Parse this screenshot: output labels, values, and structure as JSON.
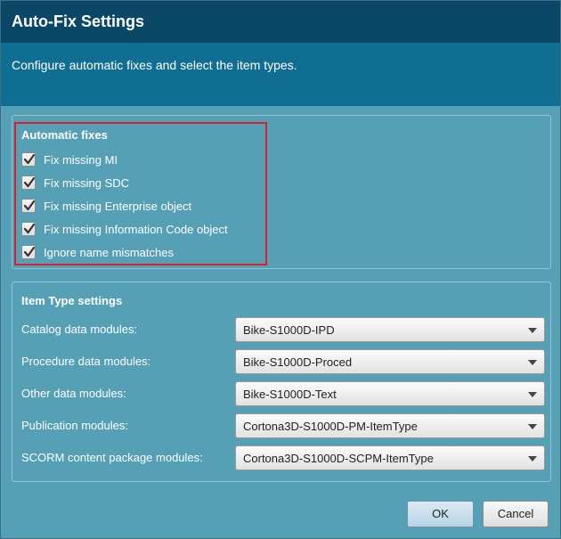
{
  "window": {
    "title": "Auto-Fix Settings"
  },
  "header": {
    "subtitle": "Configure automatic fixes and select the item types."
  },
  "automatic_fixes": {
    "title": "Automatic fixes",
    "items": [
      {
        "label": "Fix missing MI",
        "checked": true
      },
      {
        "label": "Fix missing SDC",
        "checked": true
      },
      {
        "label": "Fix missing Enterprise object",
        "checked": true
      },
      {
        "label": "Fix missing Information Code object",
        "checked": true
      },
      {
        "label": "Ignore name mismatches",
        "checked": true
      }
    ],
    "highlight_color": "#d8202f"
  },
  "item_type_settings": {
    "title": "Item Type settings",
    "fields": [
      {
        "label": "Catalog data modules:",
        "value": "Bike-S1000D-IPD"
      },
      {
        "label": "Procedure data modules:",
        "value": "Bike-S1000D-Proced"
      },
      {
        "label": "Other data modules:",
        "value": "Bike-S1000D-Text"
      },
      {
        "label": "Publication modules:",
        "value": "Cortona3D-S1000D-PM-ItemType"
      },
      {
        "label": "SCORM content package modules:",
        "value": "Cortona3D-S1000D-SCPM-ItemType"
      }
    ]
  },
  "buttons": {
    "ok": "OK",
    "cancel": "Cancel"
  },
  "colors": {
    "titlebar": "#0b4766",
    "header": "#0f6e92",
    "body": "#56a0b6"
  }
}
